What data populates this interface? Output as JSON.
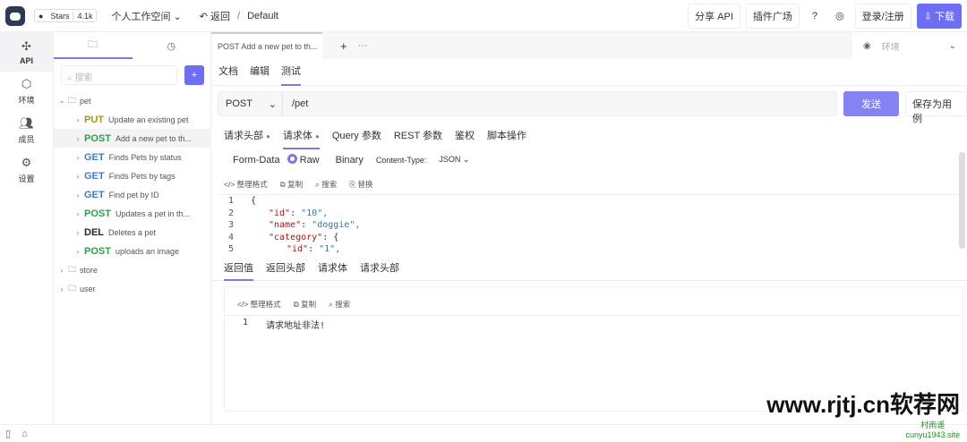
{
  "topbar": {
    "stars_label": "Stars",
    "stars_count": "4.1k",
    "workspace": "个人工作空间",
    "back": "返回",
    "separator": "/",
    "project": "Default",
    "share": "分享 API",
    "plugins": "插件广场",
    "login": "登录/注册",
    "download": "下载"
  },
  "rail": [
    {
      "label": "API",
      "icon": "api-icon"
    },
    {
      "label": "环境",
      "icon": "environment-icon"
    },
    {
      "label": "成员",
      "icon": "members-icon"
    },
    {
      "label": "设置",
      "icon": "settings-icon"
    }
  ],
  "tree": {
    "search_placeholder": "搜索",
    "add": "+",
    "folders": {
      "pet": "pet",
      "store": "store",
      "user": "user"
    },
    "items": [
      {
        "method": "PUT",
        "name": "Update an existing pet",
        "color": "#9a9a1a"
      },
      {
        "method": "POST",
        "name": "Add a new pet to th...",
        "color": "#2ea043"
      },
      {
        "method": "GET",
        "name": "Finds Pets by status",
        "color": "#3a7bd5"
      },
      {
        "method": "GET",
        "name": "Finds Pets by tags",
        "color": "#3a7bd5"
      },
      {
        "method": "GET",
        "name": "Find pet by ID",
        "color": "#3a7bd5"
      },
      {
        "method": "POST",
        "name": "Updates a pet in th...",
        "color": "#2ea043"
      },
      {
        "method": "DEL",
        "name": "Deletes a pet",
        "color": "#222222"
      },
      {
        "method": "POST",
        "name": "uploads an image",
        "color": "#2ea043"
      }
    ]
  },
  "tabs": {
    "active": "POST Add a new pet to th...",
    "add": "+",
    "more": "···",
    "env_placeholder": "环境"
  },
  "subtabs": [
    "文档",
    "编辑",
    "测试"
  ],
  "request": {
    "method": "POST",
    "url": "/pet",
    "send": "发送",
    "save": "保存为用例"
  },
  "req_tabs": [
    "请求头部",
    "请求体",
    "Query 参数",
    "REST 参数",
    "鉴权",
    "脚本操作"
  ],
  "body": {
    "form_data": "Form-Data",
    "raw": "Raw",
    "binary": "Binary",
    "content_type_label": "Content-Type:",
    "content_type": "JSON"
  },
  "tools": [
    "整理格式",
    "复制",
    "搜索",
    "替换"
  ],
  "code": [
    {
      "n": "1",
      "text": "{"
    },
    {
      "n": "2",
      "key": "\"id\"",
      "val": "\"10\","
    },
    {
      "n": "3",
      "key": "\"name\"",
      "val": "\"doggie\","
    },
    {
      "n": "4",
      "key": "\"category\"",
      "val": "{"
    },
    {
      "n": "5",
      "key": "\"id\"",
      "val": "\"1\","
    }
  ],
  "resp_tabs": [
    "返回值",
    "返回头部",
    "请求体",
    "请求头部"
  ],
  "resp_tools": [
    "整理格式",
    "复制",
    "搜索"
  ],
  "response": {
    "line": "1",
    "text": "请求地址非法!"
  },
  "watermark": {
    "site": "www.rjtj.cn软荐网",
    "author": "村雨遥",
    "author_site": "cunyu1943.site"
  },
  "accent": "#6e6ef2"
}
